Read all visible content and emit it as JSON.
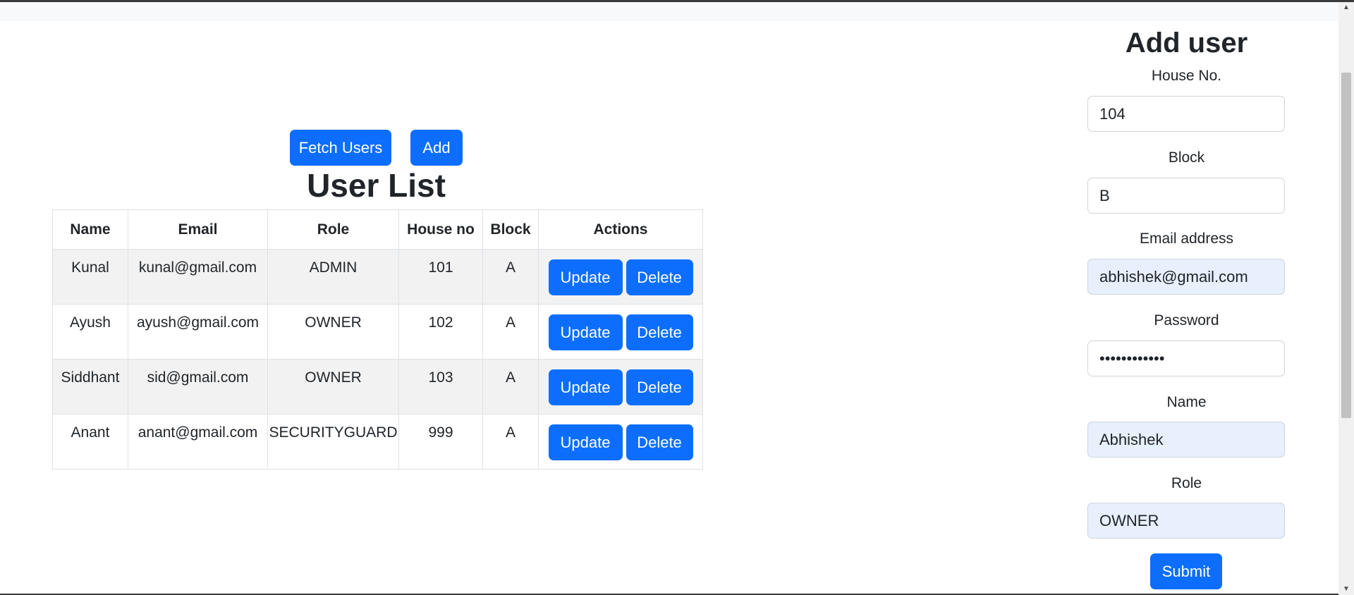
{
  "toolbar": {
    "fetch_label": "Fetch Users",
    "add_label": "Add"
  },
  "user_list": {
    "title": "User List",
    "columns": [
      "Name",
      "Email",
      "Role",
      "House no",
      "Block",
      "Actions"
    ],
    "rows": [
      {
        "name": "Kunal",
        "email": "kunal@gmail.com",
        "role": "ADMIN",
        "house": "101",
        "block": "A"
      },
      {
        "name": "Ayush",
        "email": "ayush@gmail.com",
        "role": "OWNER",
        "house": "102",
        "block": "A"
      },
      {
        "name": "Siddhant",
        "email": "sid@gmail.com",
        "role": "OWNER",
        "house": "103",
        "block": "A"
      },
      {
        "name": "Anant",
        "email": "anant@gmail.com",
        "role": "SECURITYGUARD",
        "house": "999",
        "block": "A"
      }
    ],
    "update_label": "Update",
    "delete_label": "Delete"
  },
  "form": {
    "title": "Add user",
    "house_label": "House No.",
    "house_value": "104",
    "block_label": "Block",
    "block_value": "B",
    "email_label": "Email address",
    "email_value": "abhishek@gmail.com",
    "password_label": "Password",
    "password_value": "abhishek1234",
    "name_label": "Name",
    "name_value": "Abhishek",
    "role_label": "Role",
    "role_value": "OWNER",
    "submit_label": "Submit"
  },
  "colors": {
    "primary": "#0d6efd",
    "autofill_bg": "#e8f0fe",
    "stripe": "#f2f2f2",
    "border": "#dee2e6"
  },
  "icons": [
    "scroll-up-arrow-icon",
    "scroll-down-arrow-icon"
  ]
}
